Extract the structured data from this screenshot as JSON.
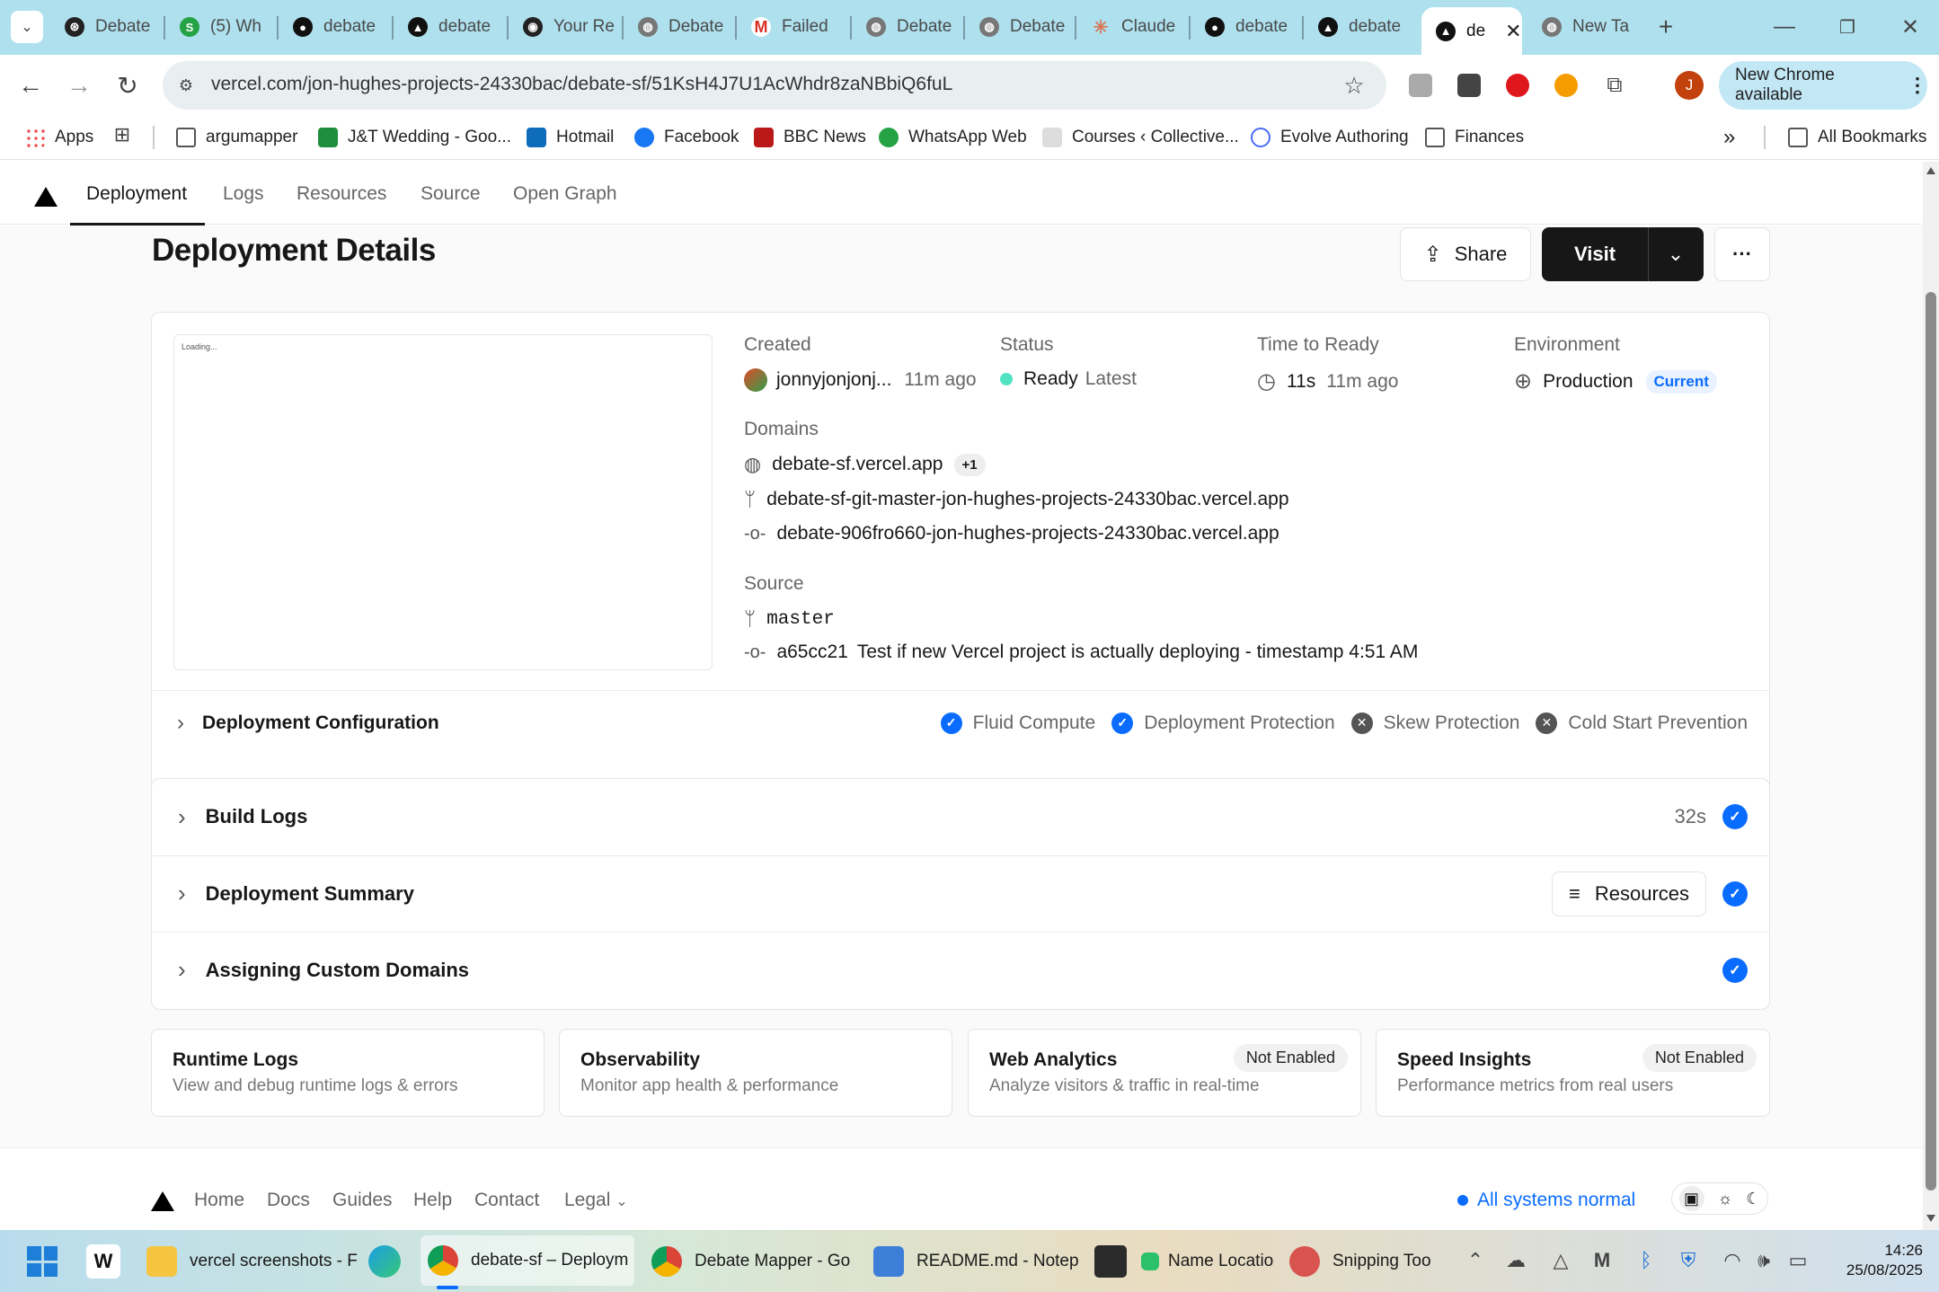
{
  "browser": {
    "tabs": [
      {
        "label": "Debate",
        "icon": "openai-icon"
      },
      {
        "label": "(5) Wh",
        "icon": "whatsapp-icon"
      },
      {
        "label": "debate",
        "icon": "app-icon"
      },
      {
        "label": "debate",
        "icon": "vercel-icon"
      },
      {
        "label": "Your Re",
        "icon": "github-icon"
      },
      {
        "label": "Debate",
        "icon": "globe-icon"
      },
      {
        "label": "Failed",
        "icon": "gmail-icon"
      },
      {
        "label": "Debate",
        "icon": "globe-icon"
      },
      {
        "label": "Debate",
        "icon": "globe-icon"
      },
      {
        "label": "Claude",
        "icon": "claude-icon"
      },
      {
        "label": "debate",
        "icon": "app-icon"
      },
      {
        "label": "debate",
        "icon": "vercel-icon"
      },
      {
        "label": "de",
        "icon": "vercel-icon",
        "active": true
      },
      {
        "label": "New Ta",
        "icon": "chrome-icon"
      }
    ],
    "url": "vercel.com/jon-hughes-projects-24330bac/debate-sf/51KsH4J7U1AcWhdr8zaNBbiQ6fuL",
    "new_chrome_label": "New Chrome available",
    "profile_initial": "J",
    "bookmarks": [
      {
        "label": "Apps"
      },
      {
        "label": "argumapper"
      },
      {
        "label": "J&T Wedding - Goo..."
      },
      {
        "label": "Hotmail"
      },
      {
        "label": "Facebook"
      },
      {
        "label": "BBC News"
      },
      {
        "label": "WhatsApp Web"
      },
      {
        "label": "Courses ‹ Collective..."
      },
      {
        "label": "Evolve Authoring"
      },
      {
        "label": "Finances"
      }
    ],
    "all_bookmarks_label": "All Bookmarks",
    "more_bookmarks": "»"
  },
  "vercel_nav": {
    "tabs": [
      "Deployment",
      "Logs",
      "Resources",
      "Source",
      "Open Graph"
    ]
  },
  "page": {
    "title": "Deployment Details",
    "share_label": "Share",
    "visit_label": "Visit",
    "more_label": "···",
    "preview_text": "Loading...",
    "created_label": "Created",
    "created_user": "jonnyjonjonj...",
    "created_ago": "11m ago",
    "status_label": "Status",
    "status_value": "Ready",
    "status_tag": "Latest",
    "ttr_label": "Time to Ready",
    "ttr_value": "11s",
    "ttr_ago": "11m ago",
    "env_label": "Environment",
    "env_value": "Production",
    "env_tag": "Current",
    "domains_label": "Domains",
    "domain_primary": "debate-sf.vercel.app",
    "domain_more": "+1",
    "domain_branch": "debate-sf-git-master-jon-hughes-projects-24330bac.vercel.app",
    "domain_commit": "debate-906fro660-jon-hughes-projects-24330bac.vercel.app",
    "source_label": "Source",
    "source_branch": "master",
    "source_sha": "a65cc21",
    "source_message": "Test if new Vercel project is actually deploying - timestamp 4:51 AM",
    "config_label": "Deployment Configuration",
    "config_items": [
      {
        "label": "Fluid Compute",
        "enabled": true
      },
      {
        "label": "Deployment Protection",
        "enabled": true
      },
      {
        "label": "Skew Protection",
        "enabled": false
      },
      {
        "label": "Cold Start Prevention",
        "enabled": false
      }
    ],
    "build_logs_label": "Build Logs",
    "build_logs_time": "32s",
    "summary_label": "Deployment Summary",
    "resources_label": "Resources",
    "domains_assign_label": "Assigning Custom Domains",
    "tiles": [
      {
        "title": "Runtime Logs",
        "sub": "View and debug runtime logs & errors",
        "badge": ""
      },
      {
        "title": "Observability",
        "sub": "Monitor app health & performance",
        "badge": ""
      },
      {
        "title": "Web Analytics",
        "sub": "Analyze visitors & traffic in real-time",
        "badge": "Not Enabled"
      },
      {
        "title": "Speed Insights",
        "sub": "Performance metrics from real users",
        "badge": "Not Enabled"
      }
    ]
  },
  "footer": {
    "links": [
      "Home",
      "Docs",
      "Guides",
      "Help",
      "Contact",
      "Legal"
    ],
    "status": "All systems normal"
  },
  "taskbar": {
    "items": [
      {
        "label": "vercel screenshots - F"
      },
      {
        "label": "debate-sf – Deploym"
      },
      {
        "label": "Debate Mapper - Go"
      },
      {
        "label": "README.md - Notep"
      },
      {
        "label": "Name Locatio"
      },
      {
        "label": "Snipping Too"
      }
    ],
    "time": "14:26",
    "date": "25/08/2025"
  },
  "colors": {
    "accent": "#0a6cff",
    "tabstrip": "#aee0ee",
    "ready": "#50e3c2"
  }
}
